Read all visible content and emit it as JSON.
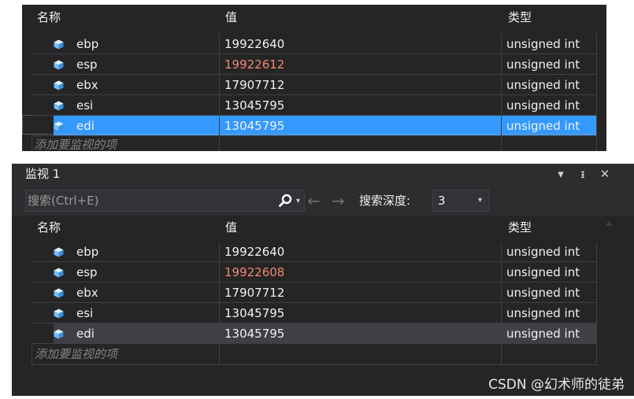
{
  "columns": {
    "name": "名称",
    "value": "值",
    "type": "类型"
  },
  "icons": {
    "variable": "variable-icon",
    "search": "search-icon"
  },
  "colors": {
    "background": "#252526",
    "selection": "#3399ff",
    "changed_value": "#f48771",
    "icon": "#75beff"
  },
  "top_panel": {
    "rows": [
      {
        "name": "ebp",
        "value": "19922640",
        "type": "unsigned int",
        "changed": false
      },
      {
        "name": "esp",
        "value": "19922612",
        "type": "unsigned int",
        "changed": true
      },
      {
        "name": "ebx",
        "value": "17907712",
        "type": "unsigned int",
        "changed": false
      },
      {
        "name": "esi",
        "value": "13045795",
        "type": "unsigned int",
        "changed": false
      },
      {
        "name": "edi",
        "value": "13045795",
        "type": "unsigned int",
        "changed": false,
        "selected": true
      }
    ],
    "add_item_placeholder": "添加要监视的项"
  },
  "bottom_panel": {
    "title": "监视 1",
    "window_buttons": {
      "dropdown": "▾",
      "pin": "ᵻ",
      "close": "✕"
    },
    "search_placeholder": "搜索(Ctrl+E)",
    "search_dropdown": "▾",
    "nav_back": "←",
    "nav_forward": "→",
    "depth_label": "搜索深度:",
    "depth_value": "3",
    "depth_caret": "▾",
    "rows": [
      {
        "name": "ebp",
        "value": "19922640",
        "type": "unsigned int",
        "changed": false
      },
      {
        "name": "esp",
        "value": "19922608",
        "type": "unsigned int",
        "changed": true
      },
      {
        "name": "ebx",
        "value": "17907712",
        "type": "unsigned int",
        "changed": false
      },
      {
        "name": "esi",
        "value": "13045795",
        "type": "unsigned int",
        "changed": false
      },
      {
        "name": "edi",
        "value": "13045795",
        "type": "unsigned int",
        "changed": false,
        "selected_inactive": true
      }
    ],
    "add_item_placeholder": "添加要监视的项"
  },
  "watermark": "CSDN @幻术师的徒弟"
}
